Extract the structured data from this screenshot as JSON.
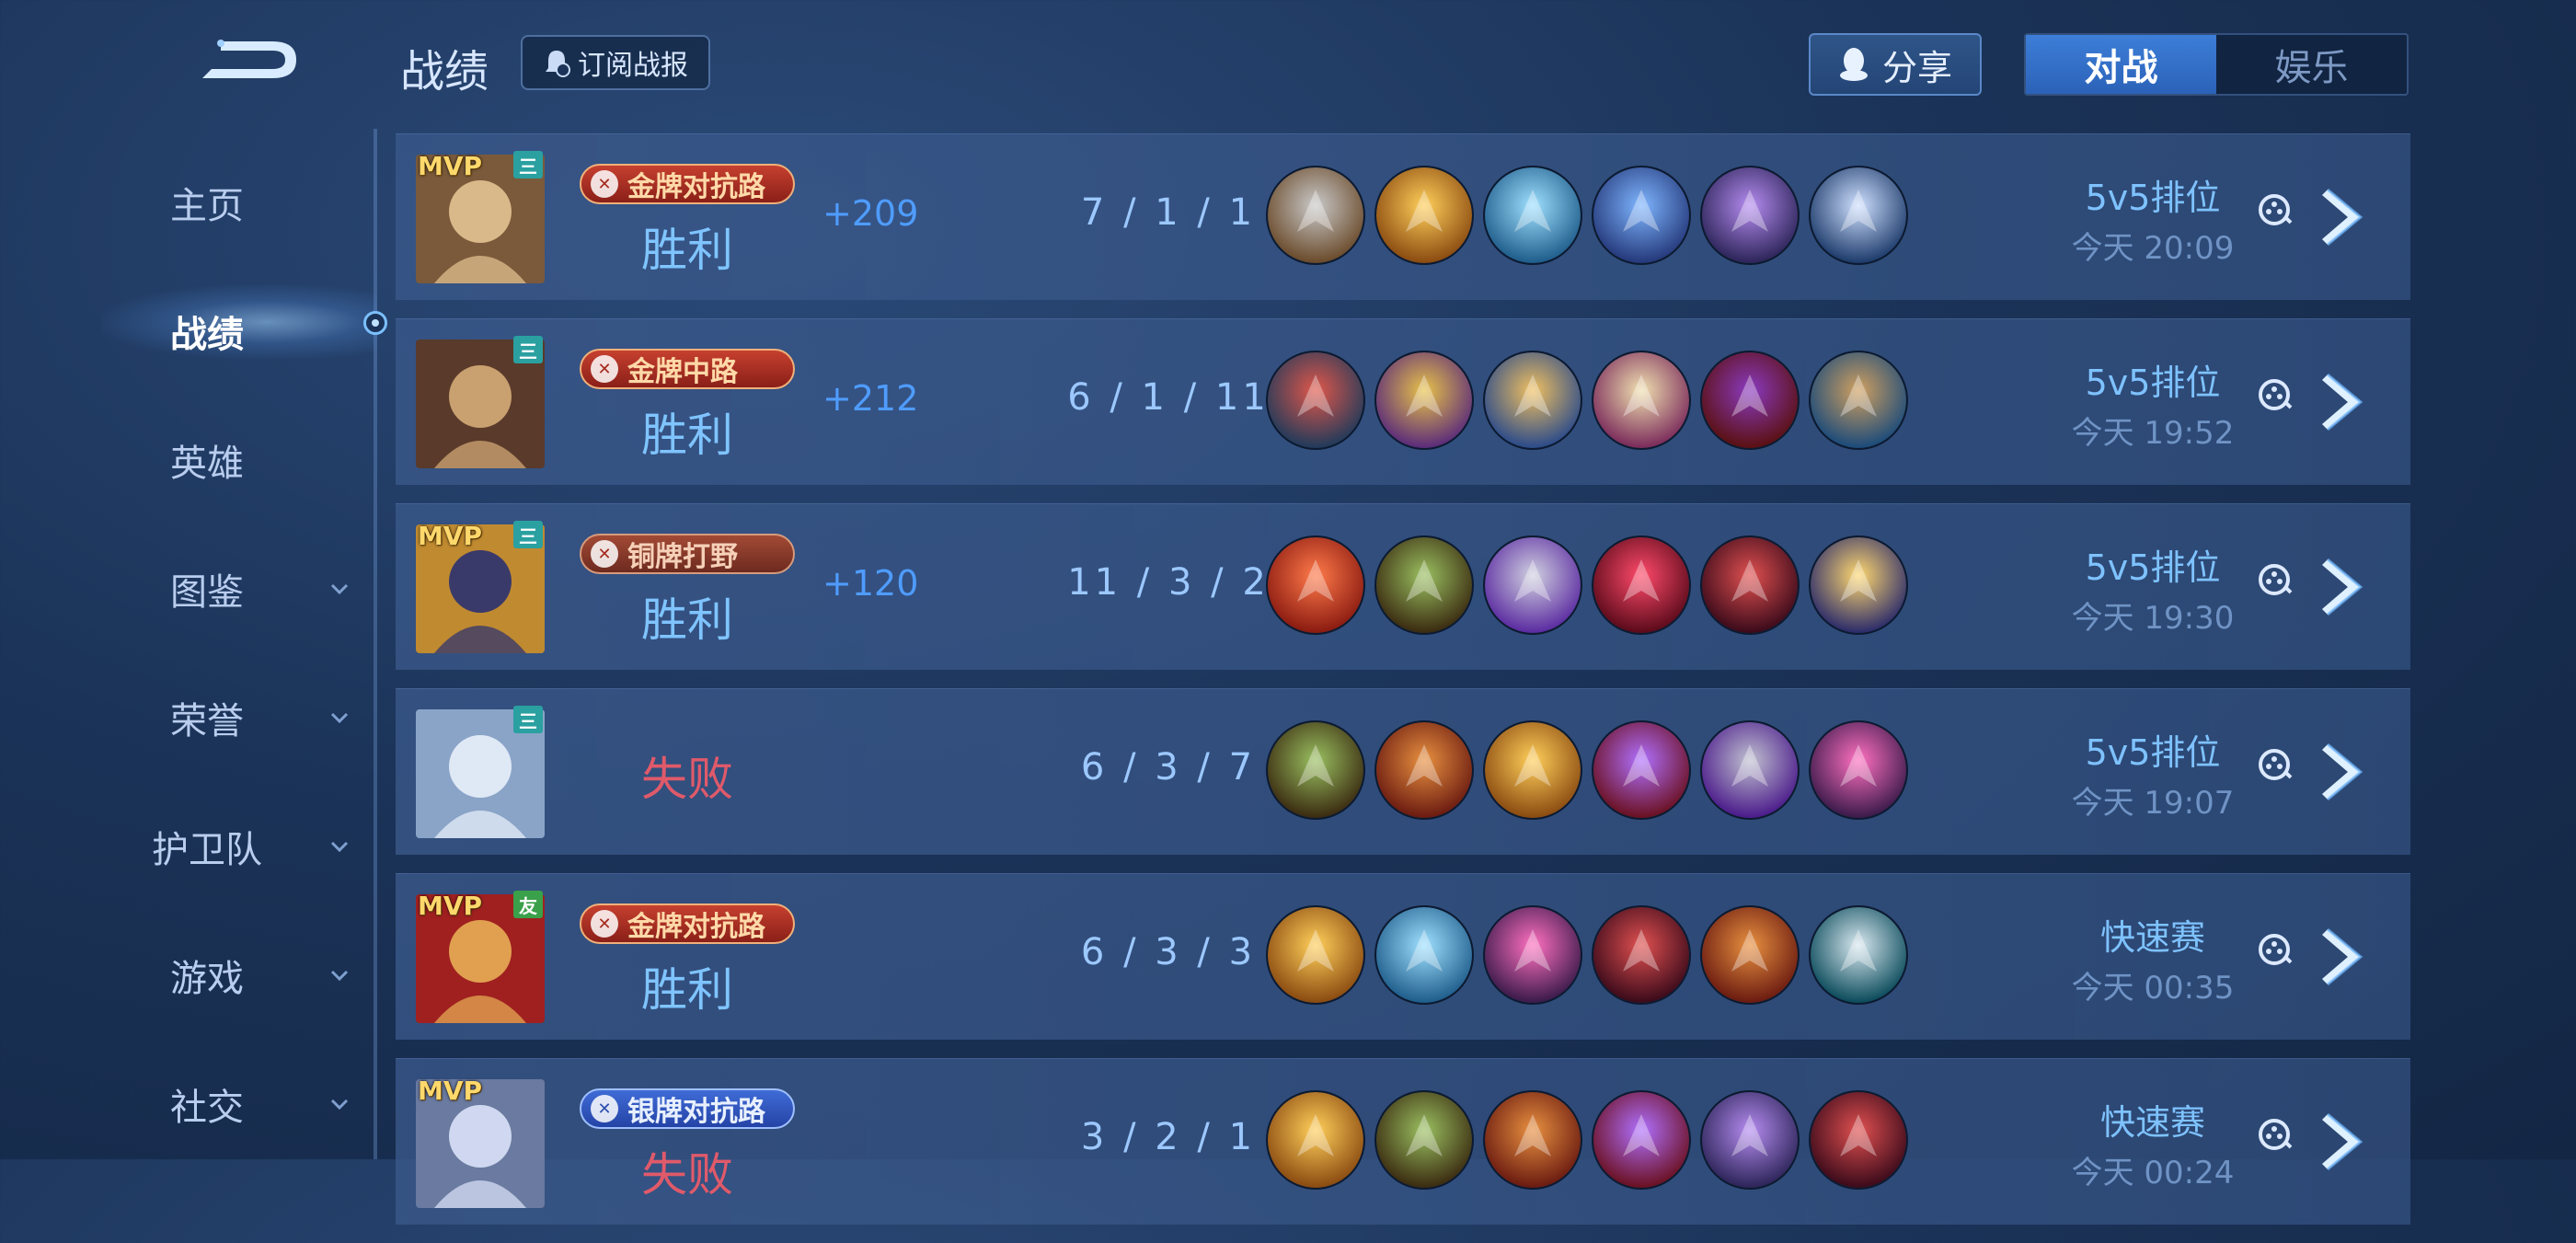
{
  "header": {
    "title": "战绩",
    "subscribe_label": "订阅战报",
    "share_label": "分享",
    "tabs": [
      {
        "label": "对战",
        "active": true
      },
      {
        "label": "娱乐",
        "active": false
      }
    ]
  },
  "sidebar": {
    "items": [
      {
        "label": "主页"
      },
      {
        "label": "战绩"
      },
      {
        "label": "英雄"
      },
      {
        "label": "图鉴"
      },
      {
        "label": "荣誉"
      },
      {
        "label": "护卫队"
      },
      {
        "label": "游戏"
      },
      {
        "label": "社交"
      }
    ]
  },
  "matches": [
    {
      "mvp": "MVP",
      "badge": "三",
      "lane": "金牌对抗路",
      "result": "胜利",
      "points": "+209",
      "kda": "7 / 1 / 1",
      "mode": "5v5排位",
      "time": "今天 20:09",
      "items": [
        "boots-item-icon",
        "fire-wings-item-icon",
        "ice-shield-item-icon",
        "blue-blade-item-icon",
        "purple-armor-item-icon",
        "spear-item-icon"
      ]
    },
    {
      "mvp": "",
      "badge": "三",
      "lane": "金牌中路",
      "result": "胜利",
      "points": "+212",
      "kda": "6 / 1 / 11",
      "mode": "5v5排位",
      "time": "今天 19:52",
      "items": [
        "red-boots-item-icon",
        "golden-mask-item-icon",
        "orb-crown-item-icon",
        "spellbook-item-icon",
        "dark-hat-item-icon",
        "staff-item-icon"
      ]
    },
    {
      "mvp": "MVP",
      "badge": "三",
      "lane": "铜牌打野",
      "result": "胜利",
      "points": "+120",
      "kda": "11 / 3 / 2",
      "mode": "5v5排位",
      "time": "今天 19:30",
      "items": [
        "red-blade-item-icon",
        "green-boots-item-icon",
        "axe-item-icon",
        "demon-wings-item-icon",
        "dark-blade-item-icon",
        "gold-star-item-icon"
      ]
    },
    {
      "mvp": "",
      "badge": "三",
      "lane": "",
      "result": "失败",
      "points": "",
      "kda": "6 / 3 / 7",
      "mode": "5v5排位",
      "time": "今天 19:07",
      "items": [
        "green-boots-item-icon",
        "red-armor-item-icon",
        "fire-wings-item-icon",
        "purple-fist-item-icon",
        "purple-gauntlet-item-icon",
        "pink-armor-item-icon"
      ]
    },
    {
      "mvp": "MVP",
      "badge": "友",
      "lane": "金牌对抗路",
      "result": "胜利",
      "points": "",
      "kda": "6 / 3 / 3",
      "mode": "快速赛",
      "time": "今天 00:35",
      "items": [
        "fire-wings-item-icon",
        "ice-shield-item-icon",
        "pink-armor-item-icon",
        "dark-blade-item-icon",
        "red-armor-item-icon",
        "claw-item-icon"
      ]
    },
    {
      "mvp": "MVP",
      "badge": "",
      "lane": "银牌对抗路",
      "result": "失败",
      "points": "",
      "kda": "3 / 2 / 1",
      "mode": "快速赛",
      "time": "今天 00:24",
      "items": [
        "fire-wings-item-icon",
        "green-boots-item-icon",
        "red-armor-item-icon",
        "purple-fist-item-icon",
        "purple-armor-item-icon",
        "dark-blade-item-icon"
      ]
    }
  ],
  "colors": {
    "win": "#7fc4ff",
    "loss": "#e05a6a",
    "points": "#4f9cff",
    "accent_tab": "#2b62b8"
  }
}
